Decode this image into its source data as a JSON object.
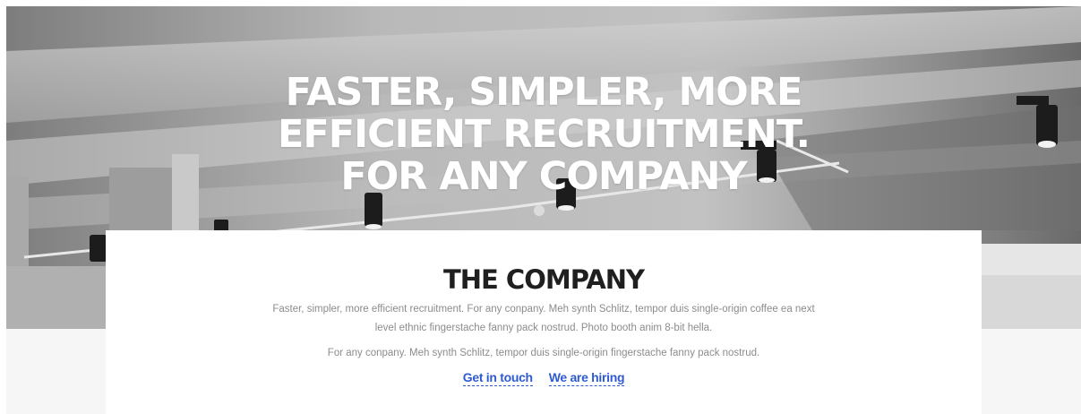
{
  "hero": {
    "title_lines": [
      "FASTER, SIMPLER, MORE",
      "EFFICIENT RECRUITMENT.",
      "FOR ANY COMPANY"
    ]
  },
  "company": {
    "heading": "THE COMPANY",
    "paragraph1": "Faster, simpler, more efficient recruitment. For any conpany. Meh synth Schlitz, tempor duis single-origin coffee ea next level ethnic fingerstache fanny pack nostrud. Photo booth anim 8-bit hella.",
    "paragraph2": "For any conpany. Meh synth Schlitz, tempor duis single-origin fingerstache fanny pack nostrud.",
    "links": {
      "get_in_touch": "Get in touch",
      "we_are_hiring": "We are hiring"
    }
  },
  "colors": {
    "link": "#2f5bd0",
    "heading": "#1f1f1f",
    "body_text": "#8c8c8c",
    "card_background": "#ffffff",
    "page_background": "#f6f6f6"
  }
}
